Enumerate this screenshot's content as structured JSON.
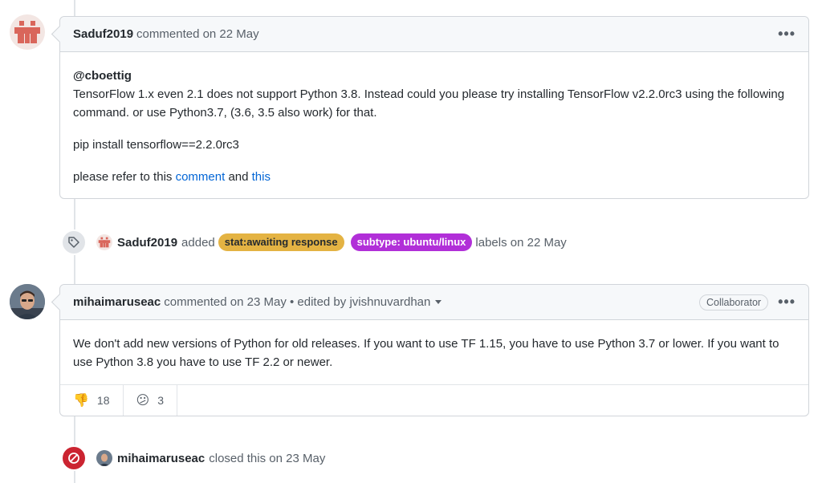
{
  "comment1": {
    "author": "Saduf2019",
    "meta": "commented on 22 May",
    "mention": "@cboettig",
    "paragraph1": "TensorFlow 1.x even 2.1 does not support Python 3.8. Instead could you please try installing TensorFlow v2.2.0rc3 using the following command. or use Python3.7, (3.6, 3.5 also work) for that.",
    "command": "pip install tensorflow==2.2.0rc3",
    "refer_prefix": "please refer to this",
    "link1": "comment",
    "and_text": "and",
    "link2": "this",
    "menu": "•••"
  },
  "event_label": {
    "author": "Saduf2019",
    "action": "added",
    "labels": [
      {
        "text": "stat:awaiting response",
        "color": "#e4b343"
      },
      {
        "text": "subtype: ubuntu/linux",
        "color": "#b12fd8"
      }
    ],
    "suffix": "labels on 22 May"
  },
  "comment2": {
    "author": "mihaimaruseac",
    "meta": "commented on 23 May • edited by jvishnuvardhan",
    "badge": "Collaborator",
    "menu": "•••",
    "body": "We don't add new versions of Python for old releases. If you want to use TF 1.15, you have to use Python 3.7 or lower. If you want to use Python 3.8 you have to use TF 2.2 or newer.",
    "reactions": [
      {
        "emoji": "👎",
        "count": "18",
        "icon": "thumbs-down-icon"
      },
      {
        "emoji": "😕",
        "count": "3",
        "icon": "confused-icon"
      }
    ]
  },
  "event_closed": {
    "author": "mihaimaruseac",
    "text": "closed this on 23 May",
    "color": "#cb2431"
  }
}
